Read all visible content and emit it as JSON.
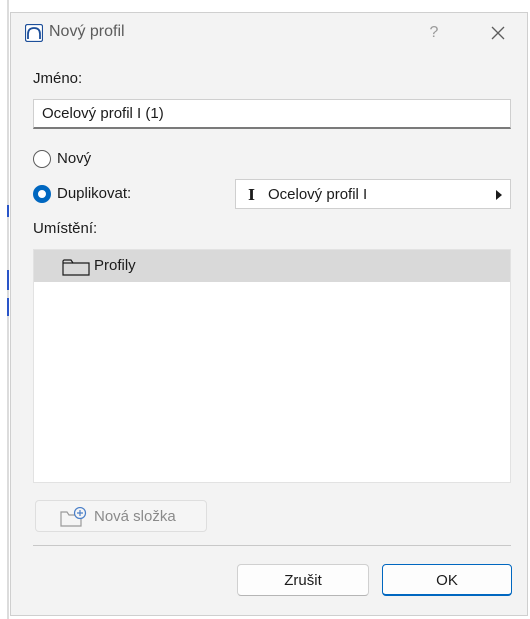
{
  "dialog": {
    "title": "Nový profil",
    "help_label": "?"
  },
  "name": {
    "label": "Jméno:",
    "value": "Ocelový profil I (1)"
  },
  "options": {
    "new_label": "Nový",
    "duplicate_label": "Duplikovat:",
    "selected": "duplicate",
    "duplicate_source": "Ocelový profil I",
    "duplicate_source_icon": "I"
  },
  "location": {
    "label": "Umístění:",
    "items": [
      {
        "label": "Profily",
        "icon": "folder-icon",
        "selected": true
      }
    ]
  },
  "toolbar": {
    "new_folder_label": "Nová složka"
  },
  "footer": {
    "cancel_label": "Zrušit",
    "ok_label": "OK"
  },
  "colors": {
    "accent": "#0067c0",
    "selection": "#d9d9d9",
    "dialog_bg": "#f3f3f3"
  }
}
